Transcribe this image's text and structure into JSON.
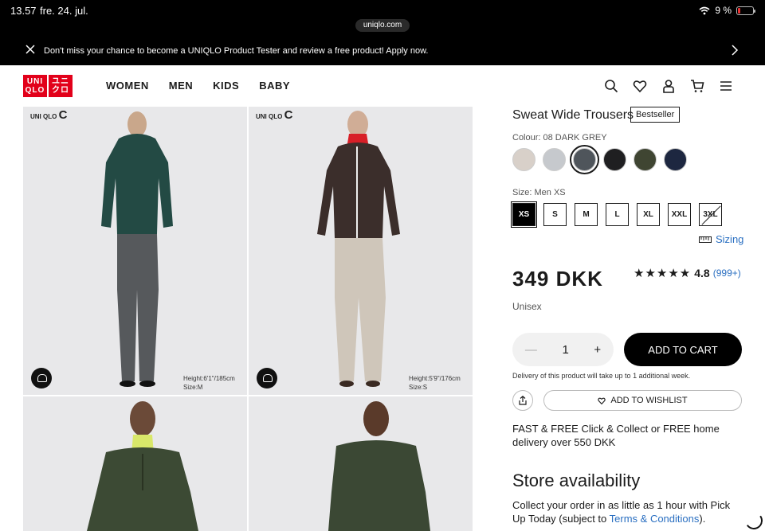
{
  "status_bar": {
    "time": "13.57",
    "date": "fre. 24. jul.",
    "url": "uniqlo.com",
    "battery": "9 %"
  },
  "promo": {
    "text": "Don't miss your chance to become a UNIQLO Product Tester and review a free product! Apply now."
  },
  "nav": {
    "logo_top": "UNI",
    "logo_bottom": "QLO",
    "logo_top2": "ユニ",
    "logo_bottom2": "クロ",
    "menu": [
      "WOMEN",
      "MEN",
      "KIDS",
      "BABY"
    ]
  },
  "gallery": {
    "brand_mark": "UNI QLO",
    "brand_c": "C",
    "tile1_info": [
      "Height:6'1\"/185cm",
      "Size:M"
    ],
    "tile2_info": [
      "Height:5'9\"/176cm",
      "Size:S"
    ]
  },
  "product": {
    "title": "Sweat Wide Trousers",
    "badge": "Bestseller",
    "colour_label": "Colour: 08 DARK GREY",
    "colours": [
      "#d8d0c9",
      "#c6c9cd",
      "#4f555b",
      "#1f1f21",
      "#3f4532",
      "#1d2740"
    ],
    "selected_colour_index": 2,
    "size_label": "Size: Men XS",
    "sizes": [
      "XS",
      "S",
      "M",
      "L",
      "XL",
      "XXL",
      "3XL"
    ],
    "selected_size": "XS",
    "unavailable_size": "3XL",
    "sizing_link": "Sizing",
    "price": "349 DKK",
    "stars": "★★★★★",
    "rating": "4.8",
    "review_count": "(999+)",
    "gender": "Unisex",
    "quantity": "1",
    "add_to_cart": "ADD TO CART",
    "delivery_note": "Delivery of this product will take up to 1 additional week.",
    "add_to_wishlist": "ADD TO WISHLIST",
    "shipping": "FAST & FREE Click & Collect or FREE home delivery over 550 DKK",
    "store_title": "Store availability",
    "collect_text": "Collect your order in as little as 1 hour with Pick Up Today (subject to ",
    "collect_link": "Terms & Conditions",
    "collect_end": ")."
  }
}
